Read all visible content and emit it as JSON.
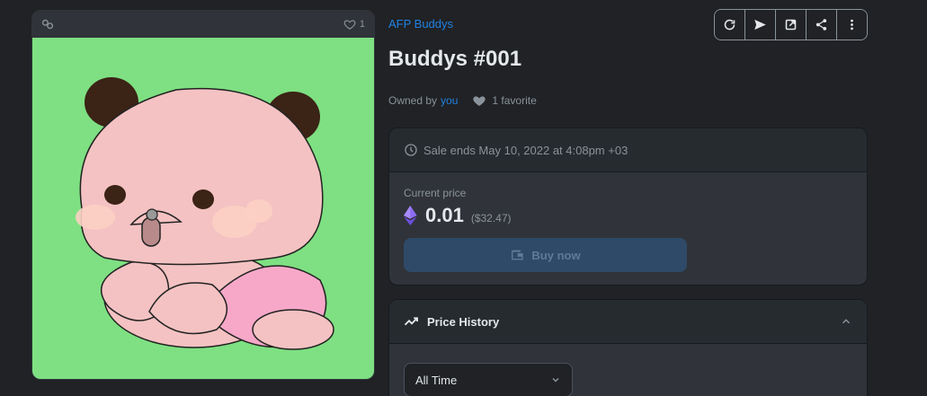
{
  "item": {
    "collection": "AFP Buddys",
    "title": "Buddys #001",
    "owned_by_label": "Owned by",
    "owner": "you",
    "favorites_text": "1 favorite",
    "image_favorite_count": "1"
  },
  "toolbar": {
    "icons": [
      "refresh-icon",
      "send-icon",
      "external-link-icon",
      "share-icon",
      "more-icon"
    ]
  },
  "sale": {
    "ends_text": "Sale ends May 10, 2022 at 4:08pm +03",
    "current_price_label": "Current price",
    "price": "0.01",
    "price_usd": "($32.47)",
    "buy_label": "Buy now"
  },
  "price_history": {
    "title": "Price History",
    "range_selected": "All Time"
  },
  "colors": {
    "background": "#202225",
    "panel": "#303339",
    "accent": "#2081e2",
    "image_bg": "#7ee082"
  }
}
